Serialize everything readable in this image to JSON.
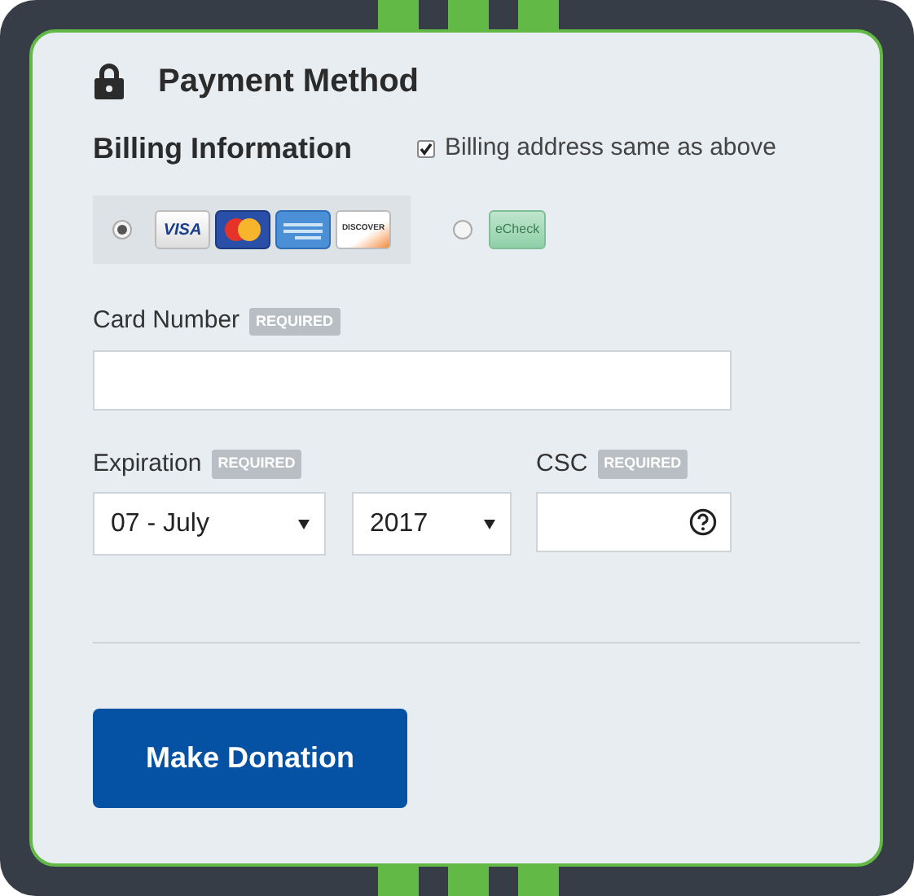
{
  "title": "Payment Method",
  "billing": {
    "heading": "Billing Information",
    "same_as_above": {
      "label": "Billing address same as above",
      "checked": true
    }
  },
  "payment_methods": [
    {
      "kind": "cards",
      "selected": true,
      "visa": "VISA",
      "discover": "DISCOVER"
    },
    {
      "kind": "echeck",
      "selected": false,
      "label": "eCheck"
    }
  ],
  "card_number": {
    "label": "Card Number",
    "badge": "REQUIRED"
  },
  "expiration": {
    "label": "Expiration",
    "badge": "REQUIRED",
    "month": "07 - July",
    "year": "2017"
  },
  "csc": {
    "label": "CSC",
    "badge": "REQUIRED"
  },
  "submit": "Make Donation"
}
